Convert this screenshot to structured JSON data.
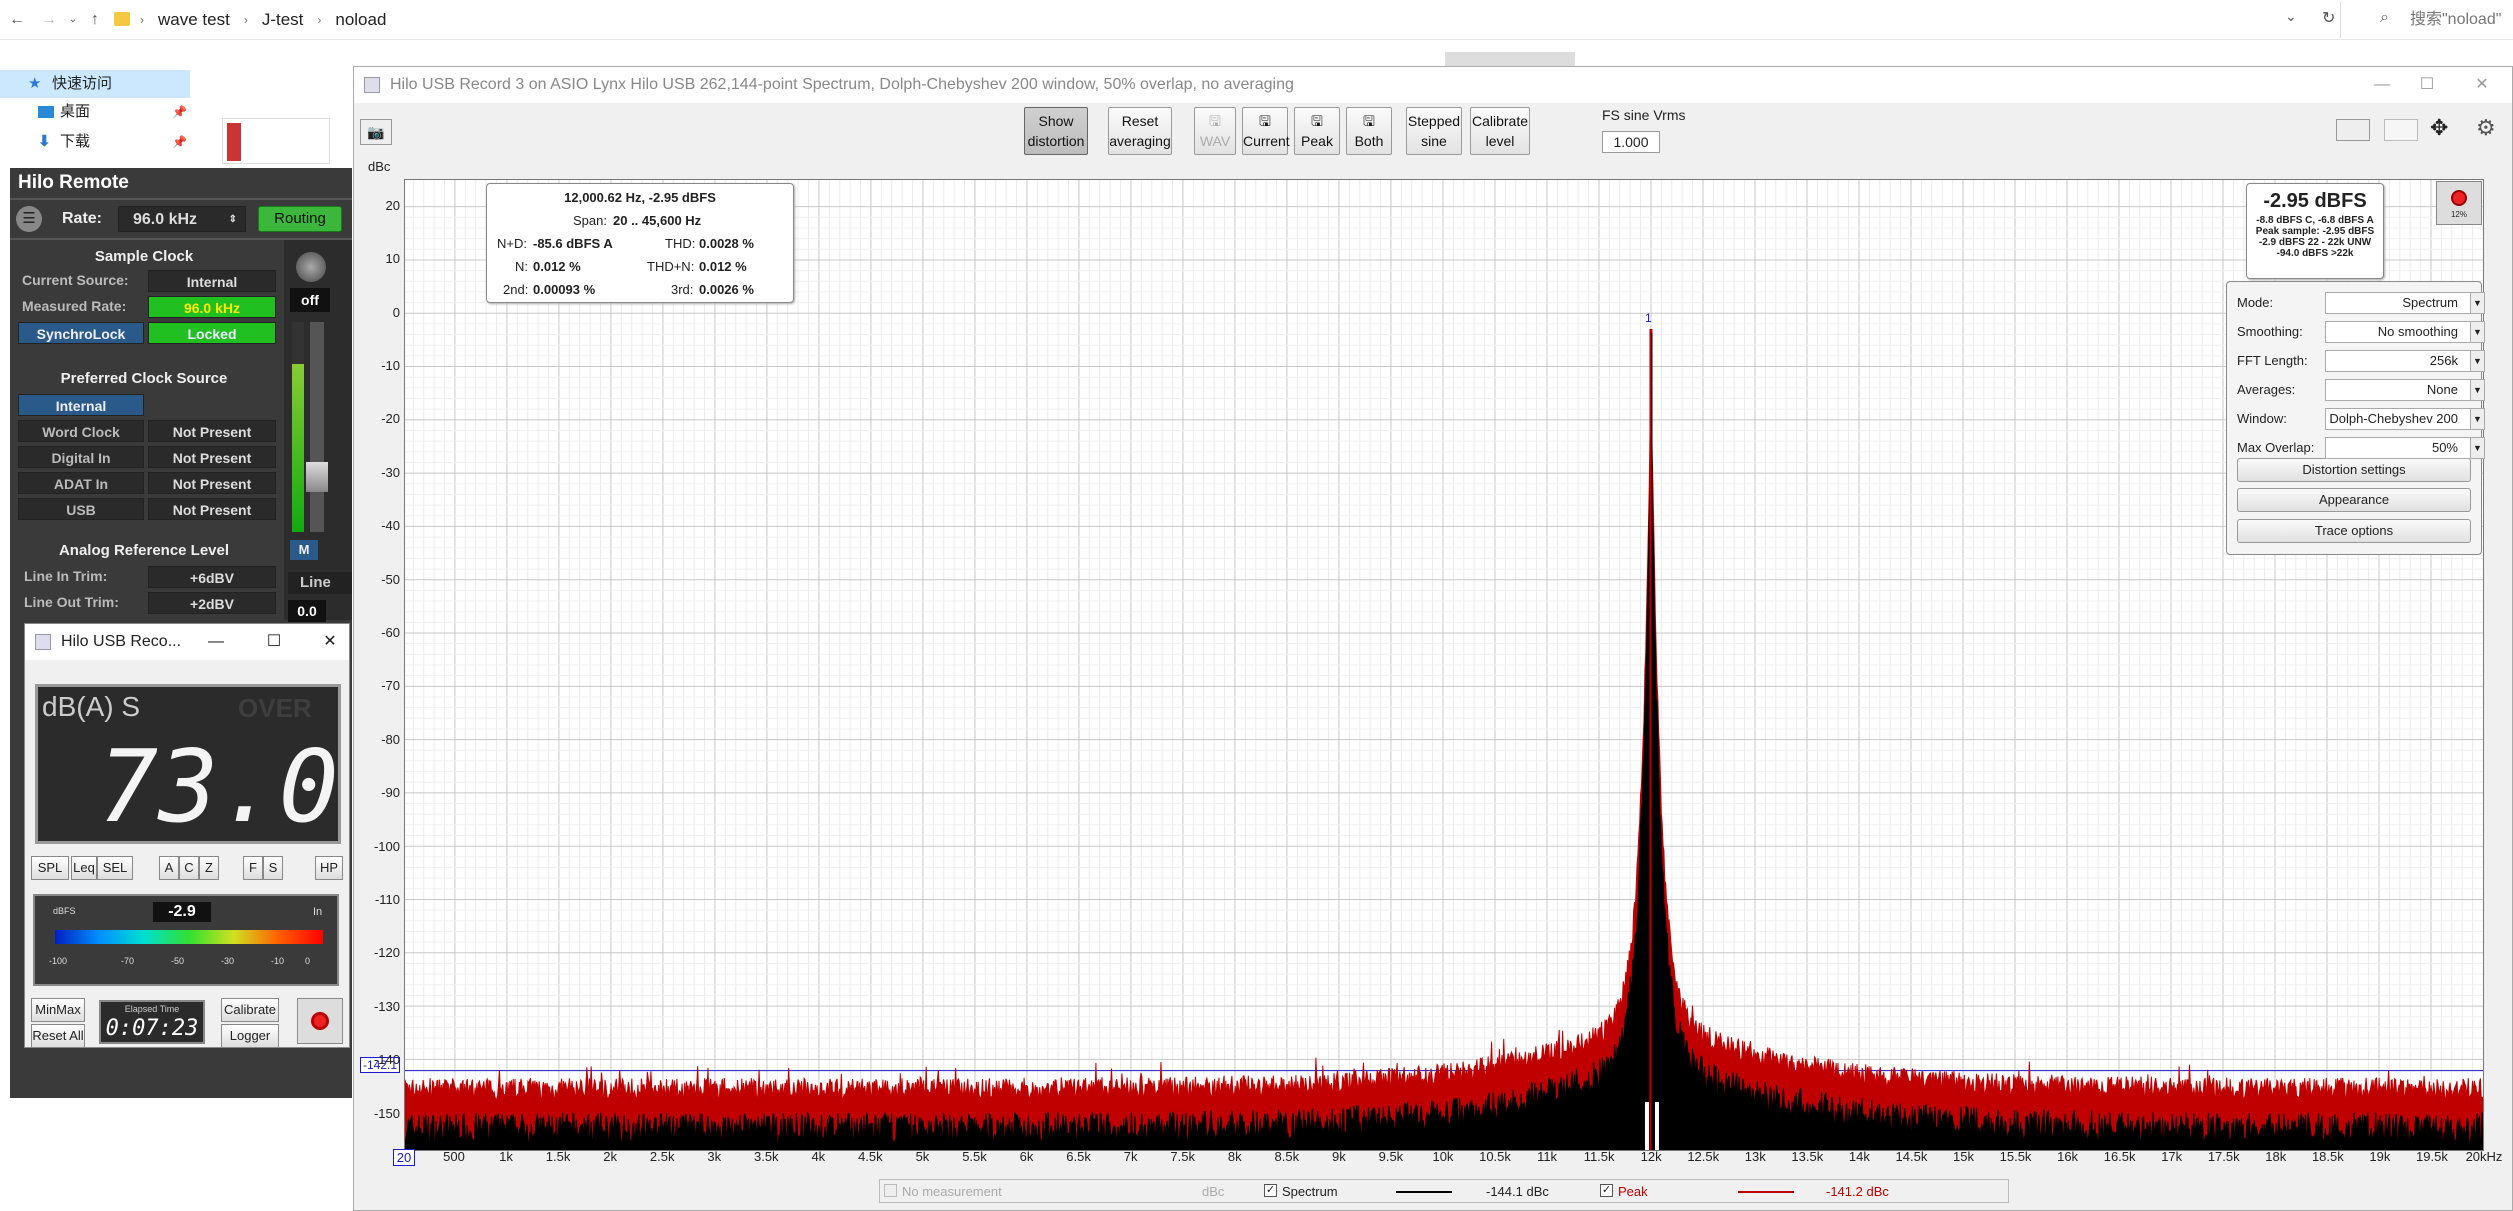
{
  "explorer": {
    "breadcrumb": [
      "wave test",
      "J-test",
      "noload"
    ],
    "search_placeholder": "搜索\"noload\"",
    "sidebar": {
      "quick_access": "快速访问",
      "desktop": "桌面",
      "downloads": "下载"
    }
  },
  "rew": {
    "title": "Hilo USB Record 3 on ASIO Lynx Hilo USB 262,144-point Spectrum, Dolph-Chebyshev 200 window, 50% overlap, no averaging",
    "toolbar": {
      "show_distortion": [
        "Show",
        "distortion"
      ],
      "reset_averaging": [
        "Reset",
        "averaging"
      ],
      "wav": "WAV",
      "current": "Current",
      "peak": "Peak",
      "both": "Both",
      "stepped_sine": [
        "Stepped",
        "sine"
      ],
      "calibrate_level": [
        "Calibrate",
        "level"
      ],
      "fs_sine_label": "FS sine Vrms",
      "fs_sine_value": "1.000"
    },
    "y_unit": "dBc",
    "y_ticks": [
      "20",
      "10",
      "0",
      "-10",
      "-20",
      "-30",
      "-40",
      "-50",
      "-60",
      "-70",
      "-80",
      "-90",
      "-100",
      "-110",
      "-120",
      "-130",
      "-140",
      "-150"
    ],
    "x_ticks": [
      "20",
      "500",
      "1k",
      "1.5k",
      "2k",
      "2.5k",
      "3k",
      "3.5k",
      "4k",
      "4.5k",
      "5k",
      "5.5k",
      "6k",
      "6.5k",
      "7k",
      "7.5k",
      "8k",
      "8.5k",
      "9k",
      "9.5k",
      "10k",
      "10.5k",
      "11k",
      "11.5k",
      "12k",
      "12.5k",
      "13k",
      "13.5k",
      "14k",
      "14.5k",
      "15k",
      "15.5k",
      "16k",
      "16.5k",
      "17k",
      "17.5k",
      "18k",
      "18.5k",
      "19k",
      "19.5k",
      "20kHz"
    ],
    "cursor_value": "-142.1",
    "marker_label": "1",
    "info": {
      "header": "12,000.62 Hz, -2.95 dBFS",
      "span_label": "Span:",
      "span_value": "20 .. 45,600 Hz",
      "nd_label": "N+D:",
      "nd_value": "-85.6 dBFS A",
      "thd_label": "THD:",
      "thd_value": "0.0028 %",
      "n_label": "N:",
      "n_value": "0.012 %",
      "thdn_label": "THD+N:",
      "thdn_value": "0.012 %",
      "h2_label": "2nd:",
      "h2_value": "0.00093 %",
      "h3_label": "3rd:",
      "h3_value": "0.0026 %"
    },
    "level": {
      "main": "-2.95 dBFS",
      "l1": "-8.8 dBFS C, -6.8 dBFS A",
      "l2": "Peak sample: -2.95 dBFS",
      "l3": "-2.9 dBFS 22 - 22k UNW",
      "l4": "-94.0 dBFS >22k",
      "rec_pct": "12%"
    },
    "controls": [
      {
        "label": "Mode:",
        "value": "Spectrum"
      },
      {
        "label": "Smoothing:",
        "value": "No  smoothing"
      },
      {
        "label": "FFT Length:",
        "value": "256k"
      },
      {
        "label": "Averages:",
        "value": "None"
      },
      {
        "label": "Window:",
        "value": "Dolph-Chebyshev 200"
      },
      {
        "label": "Max Overlap:",
        "value": "50%"
      }
    ],
    "buttons": {
      "distortion_settings": "Distortion settings",
      "appearance": "Appearance",
      "trace_options": "Trace options"
    },
    "legend": {
      "no_measurement": "No measurement",
      "dbc": "dBc",
      "spectrum": "Spectrum",
      "spectrum_value": "-144.1 dBc",
      "peak": "Peak",
      "peak_value": "-141.2 dBc"
    },
    "colors": {
      "peak": "#c00000",
      "spectrum": "#000000",
      "marker": "#1a1ad0"
    }
  },
  "hilo": {
    "title": "Hilo Remote",
    "rate_label": "Rate:",
    "rate_value": "96.0 kHz",
    "routing": "Routing",
    "sample_clock": "Sample Clock",
    "current_source_label": "Current Source:",
    "current_source_value": "Internal",
    "measured_rate_label": "Measured Rate:",
    "measured_rate_value": "96.0 kHz",
    "synchrolock": "SynchroLock",
    "locked": "Locked",
    "preferred": "Preferred Clock Source",
    "internal": "Internal",
    "sources": [
      {
        "name": "Word Clock",
        "status": "Not Present"
      },
      {
        "name": "Digital In",
        "status": "Not Present"
      },
      {
        "name": "ADAT In",
        "status": "Not Present"
      },
      {
        "name": "USB",
        "status": "Not Present"
      }
    ],
    "analog_ref": "Analog Reference Level",
    "line_in_label": "Line In Trim:",
    "line_in_value": "+6dBV",
    "line_out_label": "Line Out Trim:",
    "line_out_value": "+2dBV",
    "off": "off",
    "m": "M",
    "line": "Line",
    "vol": "0.0"
  },
  "spl": {
    "title": "Hilo USB Reco...",
    "weighting": "dB(A) S",
    "over": "OVER",
    "value": "73.0",
    "buttons": [
      "SPL",
      "Leq",
      "SEL",
      "A",
      "C",
      "Z",
      "F",
      "S",
      "HP"
    ],
    "meter_label": "dBFS",
    "meter_value": "-2.9",
    "meter_in": "In",
    "meter_ticks": [
      "-100",
      "-70",
      "-50",
      "-30",
      "-10",
      "0"
    ],
    "minmax": "MinMax",
    "reset_all": "Reset All",
    "elapsed_label": "Elapsed Time",
    "elapsed_value": "0:07:23",
    "calibrate": "Calibrate",
    "logger": "Logger"
  }
}
